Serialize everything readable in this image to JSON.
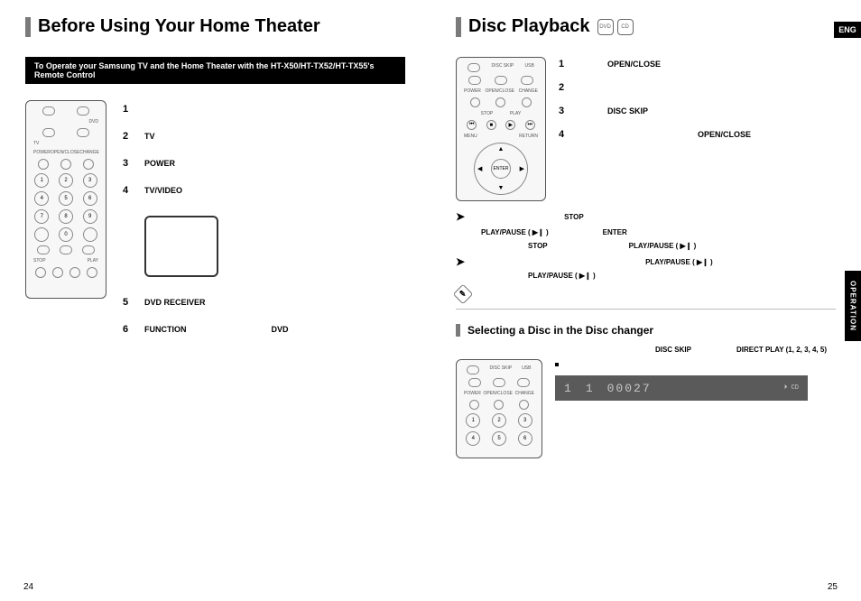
{
  "lang_tab": "ENG",
  "operation_tab": "OPERATION",
  "page_numbers": {
    "left": "24",
    "right": "25"
  },
  "left": {
    "title": "Before Using Your Home Theater",
    "instruction": "To Operate your Samsung TV and the Home Theater with the HT-X50/HT-TX52/HT-TX55's Remote Control",
    "steps": {
      "s1": {
        "n": "1"
      },
      "s2": {
        "n": "2",
        "t": "TV"
      },
      "s3": {
        "n": "3",
        "t": "POWER"
      },
      "s4": {
        "n": "4",
        "t": "TV/VIDEO"
      },
      "s5": {
        "n": "5",
        "t": "DVD RECEIVER"
      },
      "s6": {
        "n": "6",
        "t": "FUNCTION",
        "t2": "DVD"
      }
    },
    "remote": {
      "top_labels": {
        "a": "DVD",
        "b": "TV"
      },
      "buttons": [
        "1",
        "2",
        "3",
        "4",
        "5",
        "6",
        "7",
        "8",
        "9",
        "0"
      ],
      "row_labels": {
        "power": "POWER",
        "rew": "STOP",
        "play": "PLAY",
        "open": "OPEN/CLOSE",
        "change": "CHANGE"
      }
    }
  },
  "right": {
    "title": "Disc Playback",
    "disc_icons": {
      "a": "DVD",
      "b": "CD"
    },
    "steps": {
      "s1": {
        "n": "1",
        "t": "OPEN/CLOSE"
      },
      "s2": {
        "n": "2"
      },
      "s3": {
        "n": "3",
        "t": "DISC SKIP"
      },
      "s4": {
        "n": "4",
        "t": "OPEN/CLOSE"
      }
    },
    "labels": {
      "stop": "STOP",
      "play_pause": "PLAY/PAUSE ( ▶❙ )",
      "enter": "ENTER"
    },
    "remote2": {
      "labels": {
        "power": "POWER",
        "open": "OPEN/CLOSE",
        "change": "CHANGE",
        "stop": "STOP",
        "play": "PLAY",
        "menu": "MENU",
        "return": "RETURN",
        "enter": "ENTER",
        "disc_skip": "DISC SKIP",
        "usb": "USB"
      }
    },
    "section2": {
      "title": "Selecting a Disc in the Disc changer",
      "labels": {
        "disc_skip": "DISC SKIP",
        "direct_play": "DIRECT PLAY (1, 2, 3, 4, 5)"
      },
      "lcd": {
        "track": "1",
        "idx": "1",
        "time": "00027",
        "icons": "⏵ CD"
      }
    }
  }
}
